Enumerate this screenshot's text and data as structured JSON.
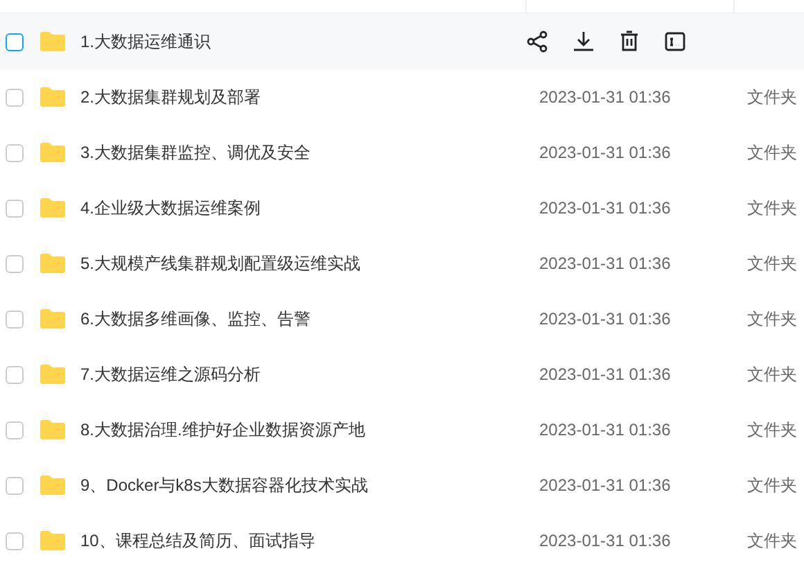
{
  "rows": [
    {
      "name": "1.大数据运维通识",
      "hovered": true,
      "checked": false
    },
    {
      "name": "2.大数据集群规划及部署",
      "modified": "2023-01-31 01:36",
      "type": "文件夹",
      "hovered": false,
      "checked": false
    },
    {
      "name": "3.大数据集群监控、调优及安全",
      "modified": "2023-01-31 01:36",
      "type": "文件夹",
      "hovered": false,
      "checked": false
    },
    {
      "name": "4.企业级大数据运维案例",
      "modified": "2023-01-31 01:36",
      "type": "文件夹",
      "hovered": false,
      "checked": false
    },
    {
      "name": "5.大规模产线集群规划配置级运维实战",
      "modified": "2023-01-31 01:36",
      "type": "文件夹",
      "hovered": false,
      "checked": false
    },
    {
      "name": "6.大数据多维画像、监控、告警",
      "modified": "2023-01-31 01:36",
      "type": "文件夹",
      "hovered": false,
      "checked": false
    },
    {
      "name": "7.大数据运维之源码分析",
      "modified": "2023-01-31 01:36",
      "type": "文件夹",
      "hovered": false,
      "checked": false
    },
    {
      "name": "8.大数据治理.维护好企业数据资源产地",
      "modified": "2023-01-31 01:36",
      "type": "文件夹",
      "hovered": false,
      "checked": false
    },
    {
      "name": "9、Docker与k8s大数据容器化技术实战",
      "modified": "2023-01-31 01:36",
      "type": "文件夹",
      "hovered": false,
      "checked": false
    },
    {
      "name": "10、课程总结及简历、面试指导",
      "modified": "2023-01-31 01:36",
      "type": "文件夹",
      "hovered": false,
      "checked": false
    }
  ]
}
